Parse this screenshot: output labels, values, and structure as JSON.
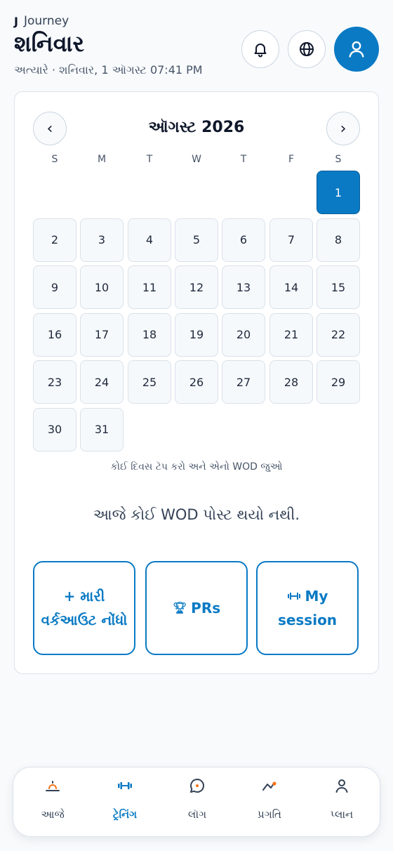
{
  "header": {
    "brand_mark": "J",
    "brand_name": "Journey",
    "title": "શનિવાર",
    "subtitle": "અત્યારે · શનિવાર, 1 ઑગસ્ટ 07:41 PM"
  },
  "calendar": {
    "month": "ઑગસ્ટ",
    "year": "2026",
    "prev_label": "‹",
    "next_label": "›",
    "weekdays": [
      "S",
      "M",
      "T",
      "W",
      "T",
      "F",
      "S"
    ],
    "days": [
      "1",
      "2",
      "3",
      "4",
      "5",
      "6",
      "7",
      "8",
      "9",
      "10",
      "11",
      "12",
      "13",
      "14",
      "15",
      "16",
      "17",
      "18",
      "19",
      "20",
      "21",
      "22",
      "23",
      "24",
      "25",
      "26",
      "27",
      "28",
      "29",
      "30",
      "31"
    ],
    "selected_day": "1",
    "hint": "કોઈ દિવસ ટૅપ કરો અને એનો WOD જુઓ",
    "empty_message": "આજે કોઈ WOD પોસ્ટ થયો નથી."
  },
  "actions": {
    "log_workout": "+ મારી વર્કઆઉટ નોંધો",
    "prs": "PRs",
    "my_session": "My session"
  },
  "bottom_nav": {
    "items": [
      {
        "label": "આજે",
        "icon": "sunrise-icon"
      },
      {
        "label": "ટ્રેનિંગ",
        "icon": "dumbbell-icon"
      },
      {
        "label": "લૉગ",
        "icon": "chat-icon"
      },
      {
        "label": "પ્રગતિ",
        "icon": "trend-icon"
      },
      {
        "label": "પ્લાન",
        "icon": "user-icon"
      }
    ],
    "active_index": 1
  },
  "colors": {
    "accent": "#0a7ac4",
    "background": "#f8fafc",
    "border": "#dbe3ea"
  }
}
